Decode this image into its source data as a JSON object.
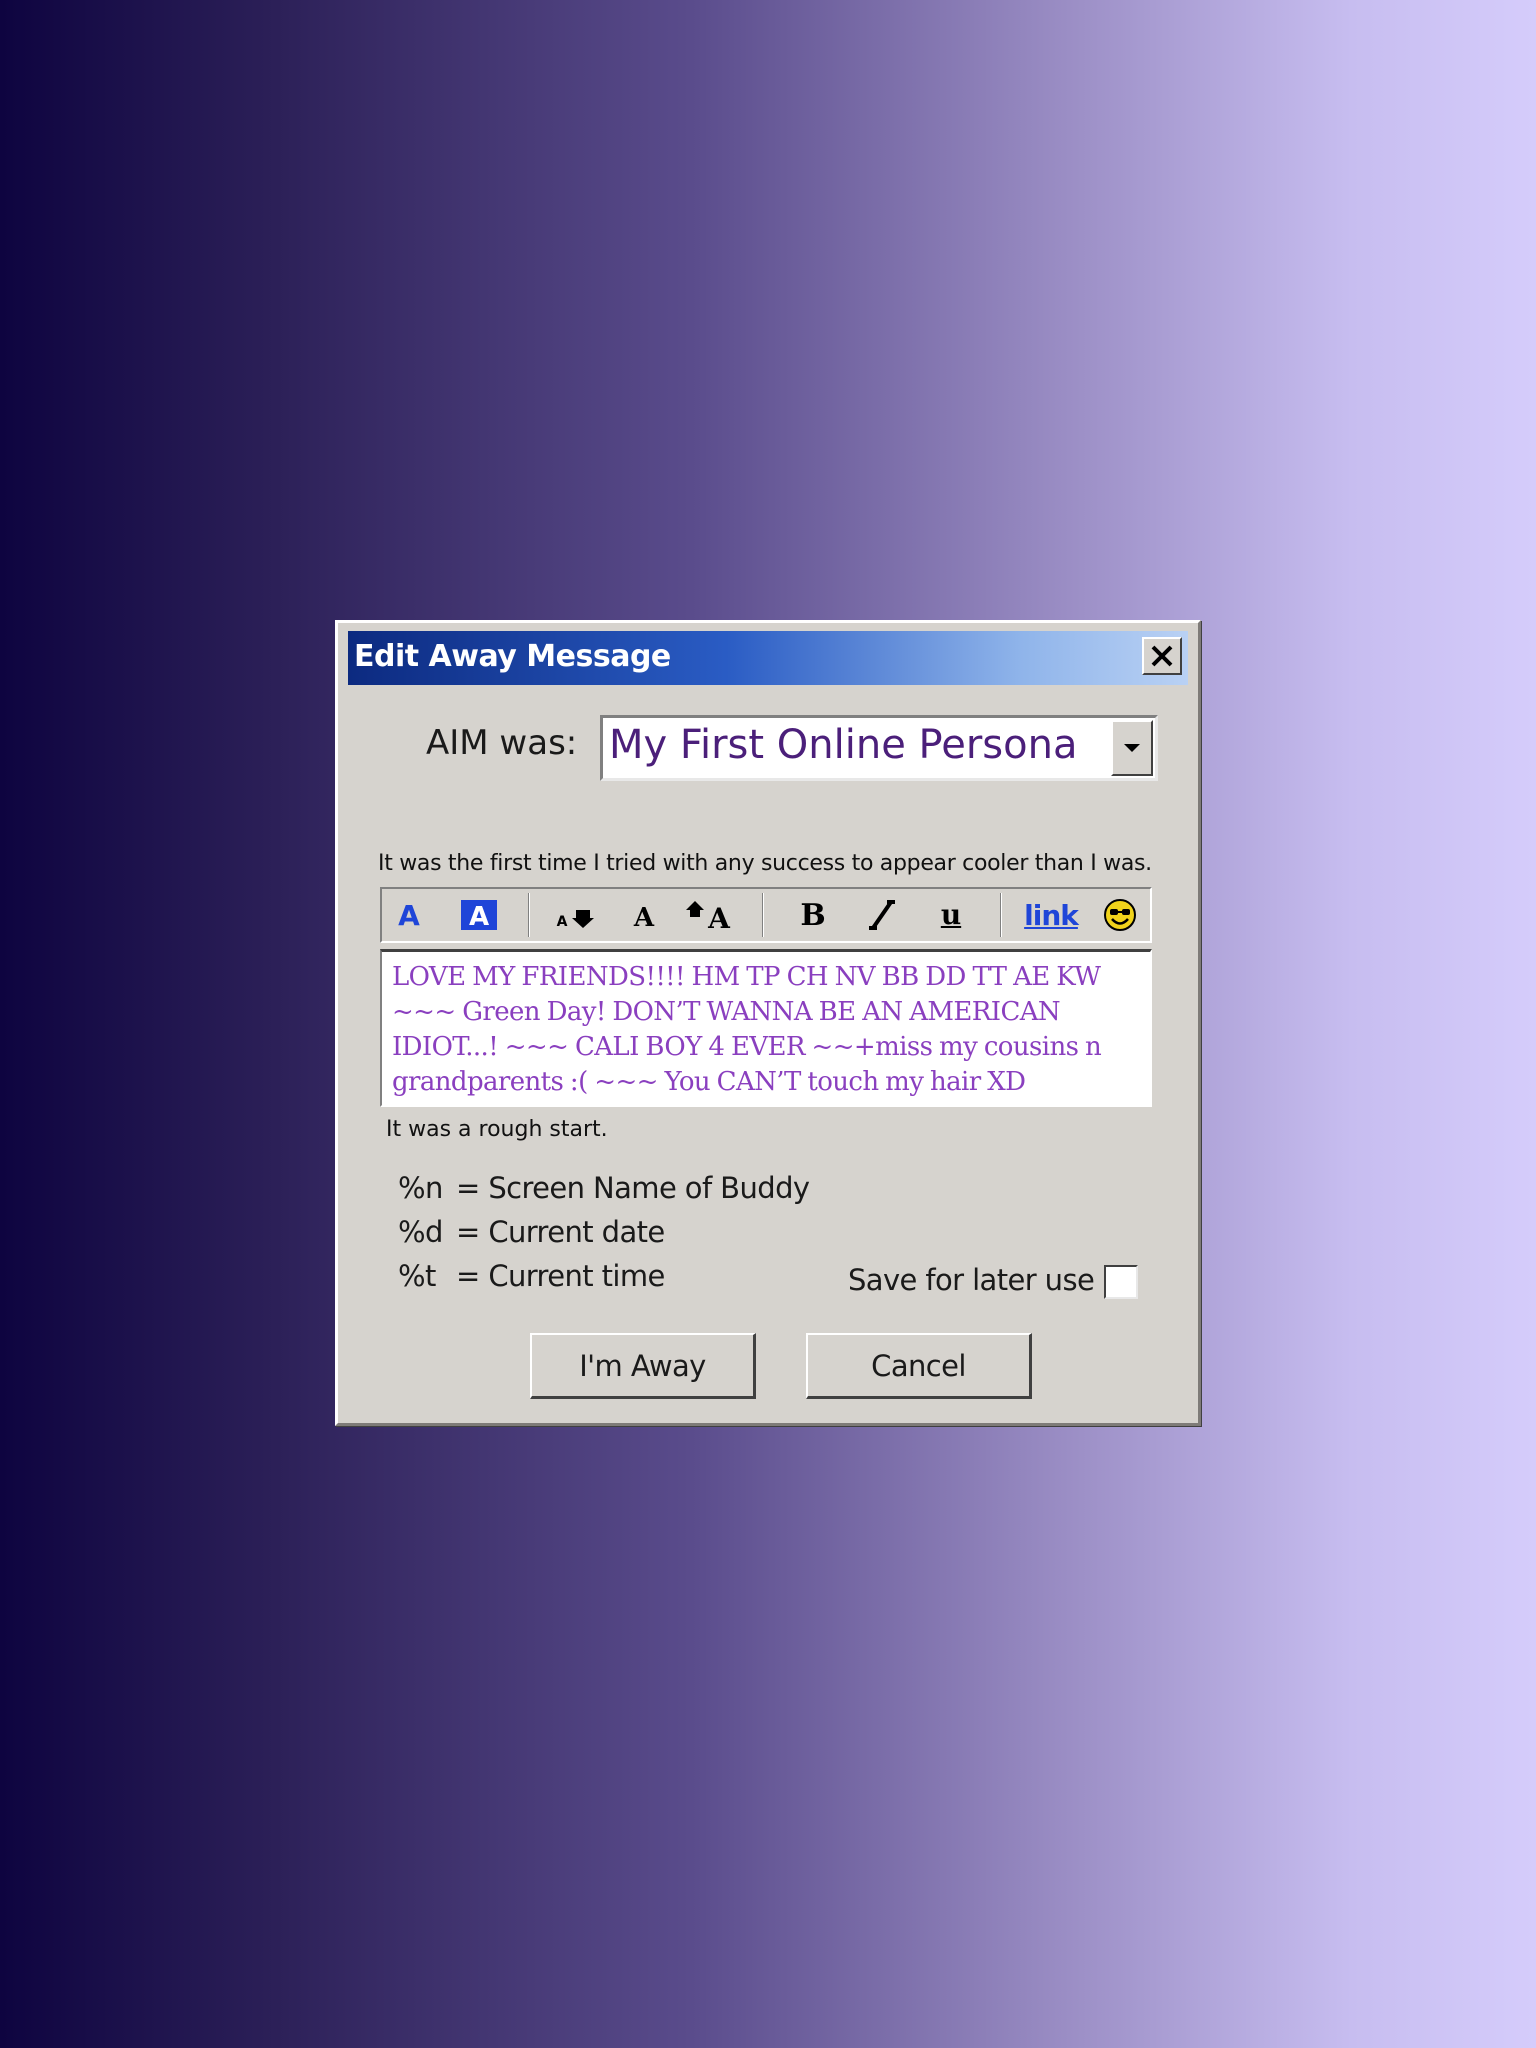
{
  "window": {
    "title": "Edit Away Message"
  },
  "aim": {
    "label": "AIM was:",
    "selected": "My First Online Persona"
  },
  "captions": {
    "top": "It was the first time I tried with any success to appear cooler than I was.",
    "bottom": "It was a rough start."
  },
  "toolbar": {
    "link_label": "link",
    "bold_label": "B",
    "underline_label": "u"
  },
  "message": {
    "text": "LOVE MY FRIENDS!!!! HM TP CH NV BB DD TT AE KW ~~~ Green Day! DON’T WANNA BE AN AMERICAN IDIOT...! ~~~ CALI BOY 4 EVER ~~+miss my cousins n grandparents :( ~~~ You CAN’T touch my hair XD"
  },
  "legend": [
    {
      "key": "%n",
      "desc": "= Screen Name of Buddy"
    },
    {
      "key": "%d",
      "desc": "= Current date"
    },
    {
      "key": "%t",
      "desc": "= Current time"
    }
  ],
  "save": {
    "label": "Save for later use",
    "checked": false
  },
  "buttons": {
    "away": "I'm Away",
    "cancel": "Cancel"
  },
  "colors": {
    "message_text": "#8a3fbf",
    "persona_text": "#4b1f7a",
    "toolbar_icon_blue": "#1f45d8"
  }
}
